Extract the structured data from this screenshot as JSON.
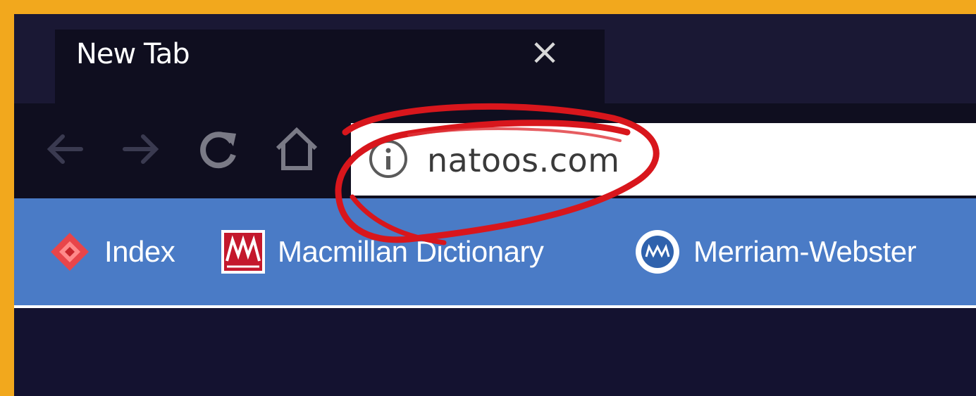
{
  "tab": {
    "title": "New Tab"
  },
  "toolbar": {
    "back": "back-arrow-icon",
    "forward": "forward-arrow-icon",
    "reload": "reload-icon",
    "home": "home-icon"
  },
  "address_bar": {
    "url": "natoos.com",
    "icon": "info-icon"
  },
  "bookmarks": [
    {
      "label": "Index",
      "icon": "index-logo-icon"
    },
    {
      "label": "Macmillan Dictionary",
      "icon": "macmillan-logo-icon"
    },
    {
      "label": "Merriam-Webster",
      "icon": "merriam-webster-logo-icon"
    }
  ],
  "colors": {
    "frame": "#f2a81d",
    "bookmarks_bar": "#4a7bc6",
    "browser_dark": "#14122a",
    "annotation": "#d8161c"
  }
}
